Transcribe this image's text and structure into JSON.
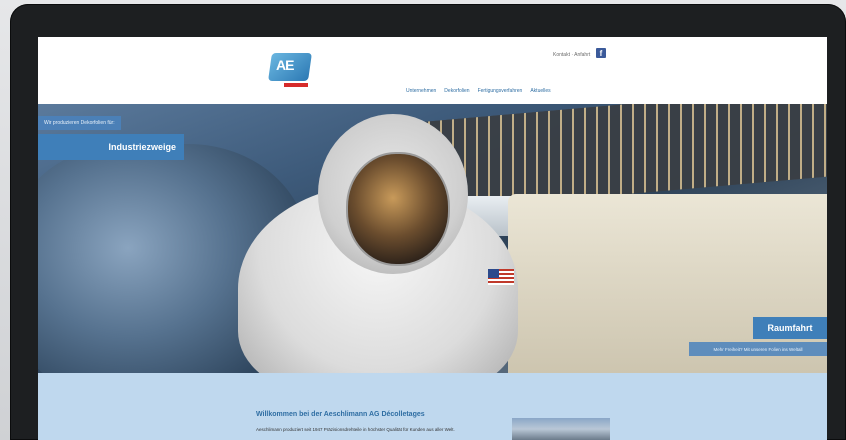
{
  "header": {
    "contact_label": "Kontakt · Anfahrt",
    "fb_glyph": "f",
    "nav": [
      "Unternehmen",
      "Dekorfolien",
      "Fertigungsverfahren",
      "Aktuelles"
    ]
  },
  "hero": {
    "tag_small_left": "Wir produzieren Dekorfolien für:",
    "tag_industry": "Industriezweige",
    "tag_space": "Raumfahrt",
    "tag_small_right": "Mehr Freiheit? Mit unseren Folien ins Weltall"
  },
  "content": {
    "welcome_title": "Willkommen bei der Aeschlimann AG Décolletages",
    "welcome_text": "Aeschlimann produziert seit 1947 Präzisionsdrehteile in höchster Qualität für Kunden aus aller Welt."
  },
  "colors": {
    "accent": "#3f7fb9",
    "nav": "#2f6ea3",
    "content_bg": "#bfd8ee"
  }
}
